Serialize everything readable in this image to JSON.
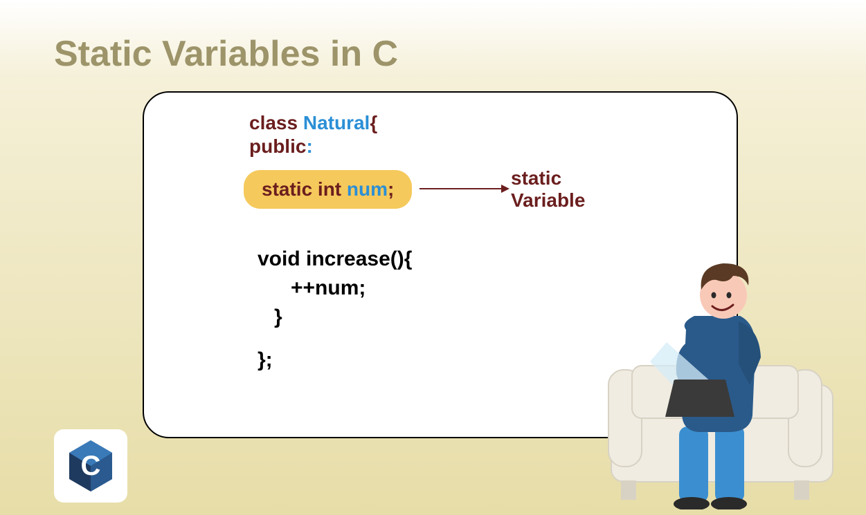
{
  "title": "Static Variables in C",
  "code": {
    "line1_keyword": "class ",
    "line1_name": "Natural",
    "line1_brace": "{",
    "line2_keyword": "public",
    "line2_colon": ":",
    "highlight_static": "static int ",
    "highlight_var": "num",
    "highlight_semi": ";",
    "annotation_line1": "static",
    "annotation_line2": "Variable",
    "fn_line1": "void increase(){",
    "fn_line2": "++num;",
    "fn_line3": "}",
    "fn_line4": "};"
  },
  "logo": {
    "letter": "C"
  }
}
